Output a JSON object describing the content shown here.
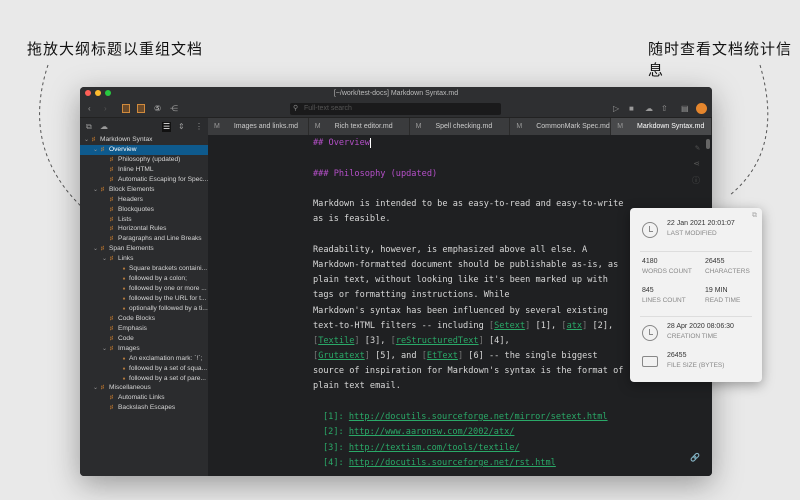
{
  "captions": {
    "left": "拖放大纲标题以重组文档",
    "right": "随时查看文档统计信息"
  },
  "window": {
    "title": "[~/work/test-docs] Markdown Syntax.md"
  },
  "toolbar": {
    "search_placeholder": "Full-text search"
  },
  "tabs": [
    {
      "badge": "M",
      "label": "Images and links.md"
    },
    {
      "badge": "M",
      "label": "Rich text editor.md"
    },
    {
      "badge": "M",
      "label": "Spell checking.md"
    },
    {
      "badge": "M",
      "label": "CommonMark Spec.md"
    },
    {
      "badge": "M",
      "label": "Markdown Syntax.md",
      "active": true
    }
  ],
  "outline": [
    {
      "label": "Markdown Syntax",
      "level": 0,
      "type": "heading",
      "expanded": true
    },
    {
      "label": "Overview",
      "level": 1,
      "type": "heading",
      "expanded": true,
      "selected": true
    },
    {
      "label": "Philosophy (updated)",
      "level": 2,
      "type": "heading"
    },
    {
      "label": "Inline HTML",
      "level": 2,
      "type": "heading"
    },
    {
      "label": "Automatic Escaping for Spec...",
      "level": 2,
      "type": "heading"
    },
    {
      "label": "Block Elements",
      "level": 1,
      "type": "heading",
      "expanded": true
    },
    {
      "label": "Headers",
      "level": 2,
      "type": "heading"
    },
    {
      "label": "Blockquotes",
      "level": 2,
      "type": "heading"
    },
    {
      "label": "Lists",
      "level": 2,
      "type": "heading"
    },
    {
      "label": "Horizontal Rules",
      "level": 2,
      "type": "heading"
    },
    {
      "label": "Paragraphs and Line Breaks",
      "level": 2,
      "type": "heading"
    },
    {
      "label": "Span Elements",
      "level": 1,
      "type": "heading",
      "expanded": true
    },
    {
      "label": "Links",
      "level": 2,
      "type": "heading",
      "expanded": true
    },
    {
      "label": "Square brackets containi...",
      "level": 3,
      "type": "bullet"
    },
    {
      "label": "followed by a colon;",
      "level": 3,
      "type": "bullet"
    },
    {
      "label": "followed by one or more ...",
      "level": 3,
      "type": "bullet"
    },
    {
      "label": "followed by the URL for t...",
      "level": 3,
      "type": "bullet"
    },
    {
      "label": "optionally followed by a ti...",
      "level": 3,
      "type": "bullet"
    },
    {
      "label": "Code Blocks",
      "level": 2,
      "type": "heading"
    },
    {
      "label": "Emphasis",
      "level": 2,
      "type": "heading"
    },
    {
      "label": "Code",
      "level": 2,
      "type": "heading"
    },
    {
      "label": "Images",
      "level": 2,
      "type": "heading",
      "expanded": true
    },
    {
      "label": "An exclamation mark: `!`;",
      "level": 3,
      "type": "bullet"
    },
    {
      "label": "followed by a set of squa...",
      "level": 3,
      "type": "bullet"
    },
    {
      "label": "followed by a set of pare...",
      "level": 3,
      "type": "bullet"
    },
    {
      "label": "Miscellaneous",
      "level": 1,
      "type": "heading",
      "expanded": true
    },
    {
      "label": "Automatic Links",
      "level": 2,
      "type": "heading"
    },
    {
      "label": "Backslash Escapes",
      "level": 2,
      "type": "heading"
    }
  ],
  "editor": {
    "h2": "## Overview",
    "h3": "### Philosophy (updated)",
    "p1": [
      "Markdown is intended to be as easy-to-read and easy-to-write",
      "as is feasible."
    ],
    "p2": [
      "Readability, however, is emphasized above all else. A",
      "Markdown-formatted document should be publishable as-is, as",
      "plain text, without looking like it's been marked up with",
      "tags or formatting instructions. While",
      "Markdown's syntax has been influenced by several existing"
    ],
    "l6a": "text-to-HTML filters -- including ",
    "setext": "Setext",
    "l6b": " [1], ",
    "atx": "atx",
    "l6c": " [2],",
    "textile": "Textile",
    "l7a": " [3], ",
    "rest": "reStructuredText",
    "l7b": " [4],",
    "gruta": "Grutatext",
    "l8a": " [5], and ",
    "ettext": "EtText",
    "l8b": " [6] -- the single biggest",
    "p3": [
      "source of inspiration for Markdown's syntax is the format of",
      "plain text email."
    ],
    "refs": [
      {
        "n": "[1]: ",
        "url": "http://docutils.sourceforge.net/mirror/setext.html"
      },
      {
        "n": "[2]: ",
        "url": "http://www.aaronsw.com/2002/atx/"
      },
      {
        "n": "[3]: ",
        "url": "http://textism.com/tools/textile/"
      },
      {
        "n": "[4]: ",
        "url": "http://docutils.sourceforge.net/rst.html"
      }
    ]
  },
  "stats": {
    "last_modified": "22 Jan 2021 20:01:07",
    "last_modified_label": "LAST MODIFIED",
    "words": "4180",
    "words_label": "WORDS COUNT",
    "characters": "26455",
    "characters_label": "CHARACTERS",
    "lines": "845",
    "lines_label": "LINES COUNT",
    "read_time": "19 MIN",
    "read_time_label": "READ TIME",
    "created": "28 Apr 2020 08:06:30",
    "created_label": "CREATION TIME",
    "file_size": "26455",
    "file_size_label": "FILE SIZE (BYTES)"
  }
}
